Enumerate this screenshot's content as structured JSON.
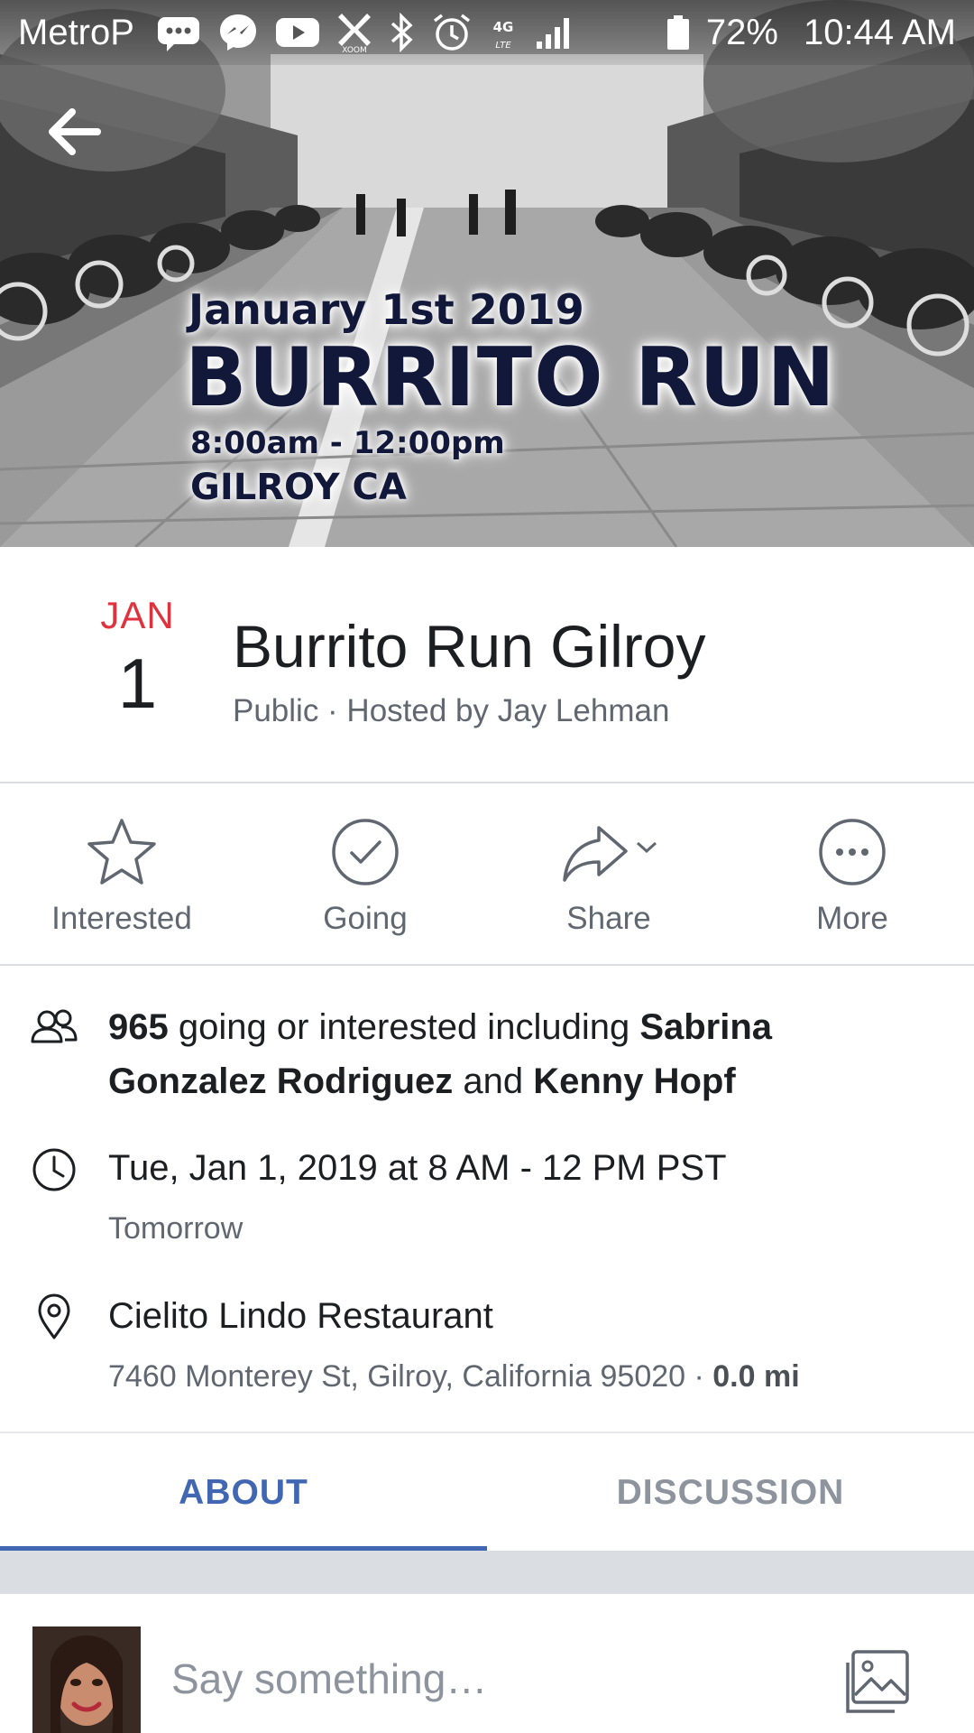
{
  "status_bar": {
    "carrier": "MetroP",
    "xoom_label": "XOOM",
    "network_label": "4G LTE",
    "battery": "72%",
    "time": "10:44 AM"
  },
  "cover": {
    "date_line": "January 1st 2019",
    "name_line": "BURRITO RUN",
    "time_line": "8:00am - 12:00pm",
    "place_line": "GILROY CA"
  },
  "event": {
    "month": "JAN",
    "day": "1",
    "title": "Burrito Run Gilroy",
    "subtitle": "Public · Hosted by Jay Lehman"
  },
  "actions": {
    "interested": "Interested",
    "going": "Going",
    "share": "Share",
    "more": "More"
  },
  "details": {
    "attendance": {
      "count": "965",
      "text": " going or interested including ",
      "person1": "Sabrina Gonzalez Rodriguez",
      "and": " and ",
      "person2": "Kenny Hopf"
    },
    "datetime": {
      "main": "Tue, Jan 1, 2019 at 8 AM - 12 PM PST",
      "sub": "Tomorrow"
    },
    "location": {
      "name": "Cielito Lindo Restaurant",
      "address": "7460 Monterey St, Gilroy, California 95020 · ",
      "distance": "0.0 mi"
    }
  },
  "tabs": {
    "about": "ABOUT",
    "discussion": "DISCUSSION"
  },
  "composer": {
    "placeholder": "Say something…"
  },
  "colors": {
    "accent": "#4267b2",
    "month": "#e0323c",
    "secondary_text": "#606770"
  },
  "icons": [
    "back-arrow-icon",
    "star-icon",
    "check-circle-icon",
    "share-arrow-icon",
    "more-dots-icon",
    "people-icon",
    "clock-icon",
    "location-pin-icon",
    "photo-icon"
  ]
}
